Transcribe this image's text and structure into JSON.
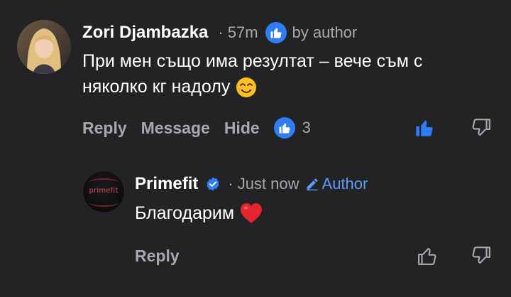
{
  "comment": {
    "author": "Zori Djambazka",
    "time": "57m",
    "badge_label": "by author",
    "text": "При мен също има резултат – вече съм с няколко кг надолу",
    "actions": {
      "reply": "Reply",
      "message": "Message",
      "hide": "Hide"
    },
    "reaction_count": "3",
    "emoji": "smiling-face-icon"
  },
  "reply": {
    "author": "Primefit",
    "logo_text": "primefit",
    "time": "Just now",
    "author_label": "Author",
    "text": "Благодарим",
    "emoji": "red-heart-icon",
    "actions": {
      "reply": "Reply"
    }
  },
  "separator": "·",
  "colors": {
    "background": "#232325",
    "accent_blue": "#2e7cf6",
    "author_blue": "#5f9bf7",
    "muted": "#a8a8ad"
  }
}
